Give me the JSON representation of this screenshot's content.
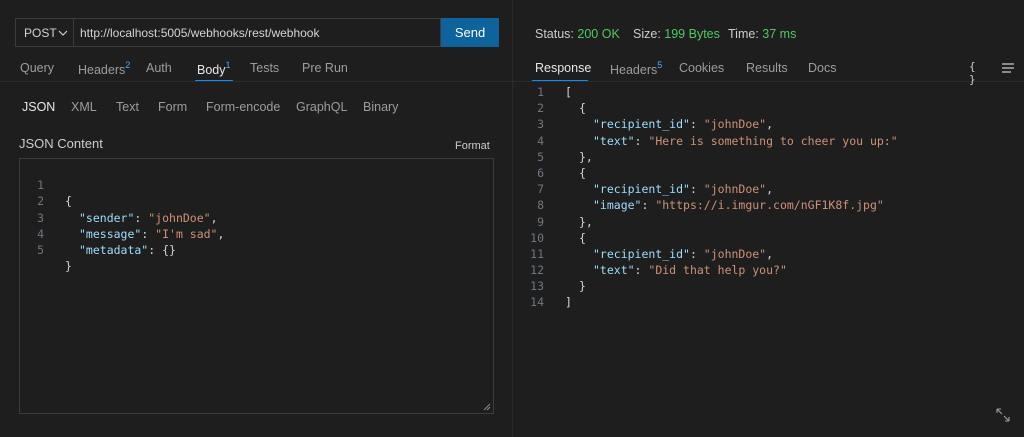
{
  "request": {
    "method": "POST",
    "url": "http://localhost:5005/webhooks/rest/webhook",
    "send_label": "Send",
    "tabs": [
      {
        "label": "Query",
        "badge": ""
      },
      {
        "label": "Headers",
        "badge": "2"
      },
      {
        "label": "Auth",
        "badge": ""
      },
      {
        "label": "Body",
        "badge": "1"
      },
      {
        "label": "Tests",
        "badge": ""
      },
      {
        "label": "Pre Run",
        "badge": ""
      }
    ],
    "active_tab": "Body",
    "body_types": [
      "JSON",
      "XML",
      "Text",
      "Form",
      "Form-encode",
      "GraphQL",
      "Binary"
    ],
    "active_body_type": "JSON",
    "content_label": "JSON Content",
    "format_label": "Format",
    "lines": [
      {
        "n": "1",
        "t": "{"
      },
      {
        "n": "2",
        "k": "\"sender\"",
        "sep": ": ",
        "v": "\"johnDoe\"",
        "end": ","
      },
      {
        "n": "3",
        "k": "\"message\"",
        "sep": ": ",
        "v": "\"I'm sad\"",
        "end": ","
      },
      {
        "n": "4",
        "k": "\"metadata\"",
        "sep": ": ",
        "p": "{}",
        "end": ""
      },
      {
        "n": "5",
        "t": "}"
      }
    ]
  },
  "response": {
    "status_label": "Status:",
    "status_value": "200 OK",
    "size_label": "Size:",
    "size_value": "199 Bytes",
    "time_label": "Time:",
    "time_value": "37 ms",
    "tabs": [
      {
        "label": "Response",
        "badge": ""
      },
      {
        "label": "Headers",
        "badge": "5"
      },
      {
        "label": "Cookies",
        "badge": ""
      },
      {
        "label": "Results",
        "badge": ""
      },
      {
        "label": "Docs",
        "badge": ""
      }
    ],
    "active_tab": "Response",
    "braces_icon": "{ }",
    "lines": [
      {
        "n": "1",
        "indent": 0,
        "t": "["
      },
      {
        "n": "2",
        "indent": 1,
        "t": "{"
      },
      {
        "n": "3",
        "indent": 2,
        "k": "\"recipient_id\"",
        "sep": ": ",
        "v": "\"johnDoe\"",
        "end": ","
      },
      {
        "n": "4",
        "indent": 2,
        "k": "\"text\"",
        "sep": ": ",
        "v": "\"Here is something to cheer you up:\"",
        "end": ""
      },
      {
        "n": "5",
        "indent": 1,
        "t": "},"
      },
      {
        "n": "6",
        "indent": 1,
        "t": "{"
      },
      {
        "n": "7",
        "indent": 2,
        "k": "\"recipient_id\"",
        "sep": ": ",
        "v": "\"johnDoe\"",
        "end": ","
      },
      {
        "n": "8",
        "indent": 2,
        "k": "\"image\"",
        "sep": ": ",
        "v": "\"https://i.imgur.com/nGF1K8f.jpg\"",
        "end": ""
      },
      {
        "n": "9",
        "indent": 1,
        "t": "},"
      },
      {
        "n": "10",
        "indent": 1,
        "t": "{"
      },
      {
        "n": "11",
        "indent": 2,
        "k": "\"recipient_id\"",
        "sep": ": ",
        "v": "\"johnDoe\"",
        "end": ","
      },
      {
        "n": "12",
        "indent": 2,
        "k": "\"text\"",
        "sep": ": ",
        "v": "\"Did that help you?\"",
        "end": ""
      },
      {
        "n": "13",
        "indent": 1,
        "t": "}"
      },
      {
        "n": "14",
        "indent": 0,
        "t": "]"
      }
    ]
  },
  "colors": {
    "accent": "#0e639c",
    "status_ok": "#4ec960",
    "json_key": "#9cdcfe",
    "json_string": "#ce9178",
    "tab_underline": "#0e8cff"
  }
}
